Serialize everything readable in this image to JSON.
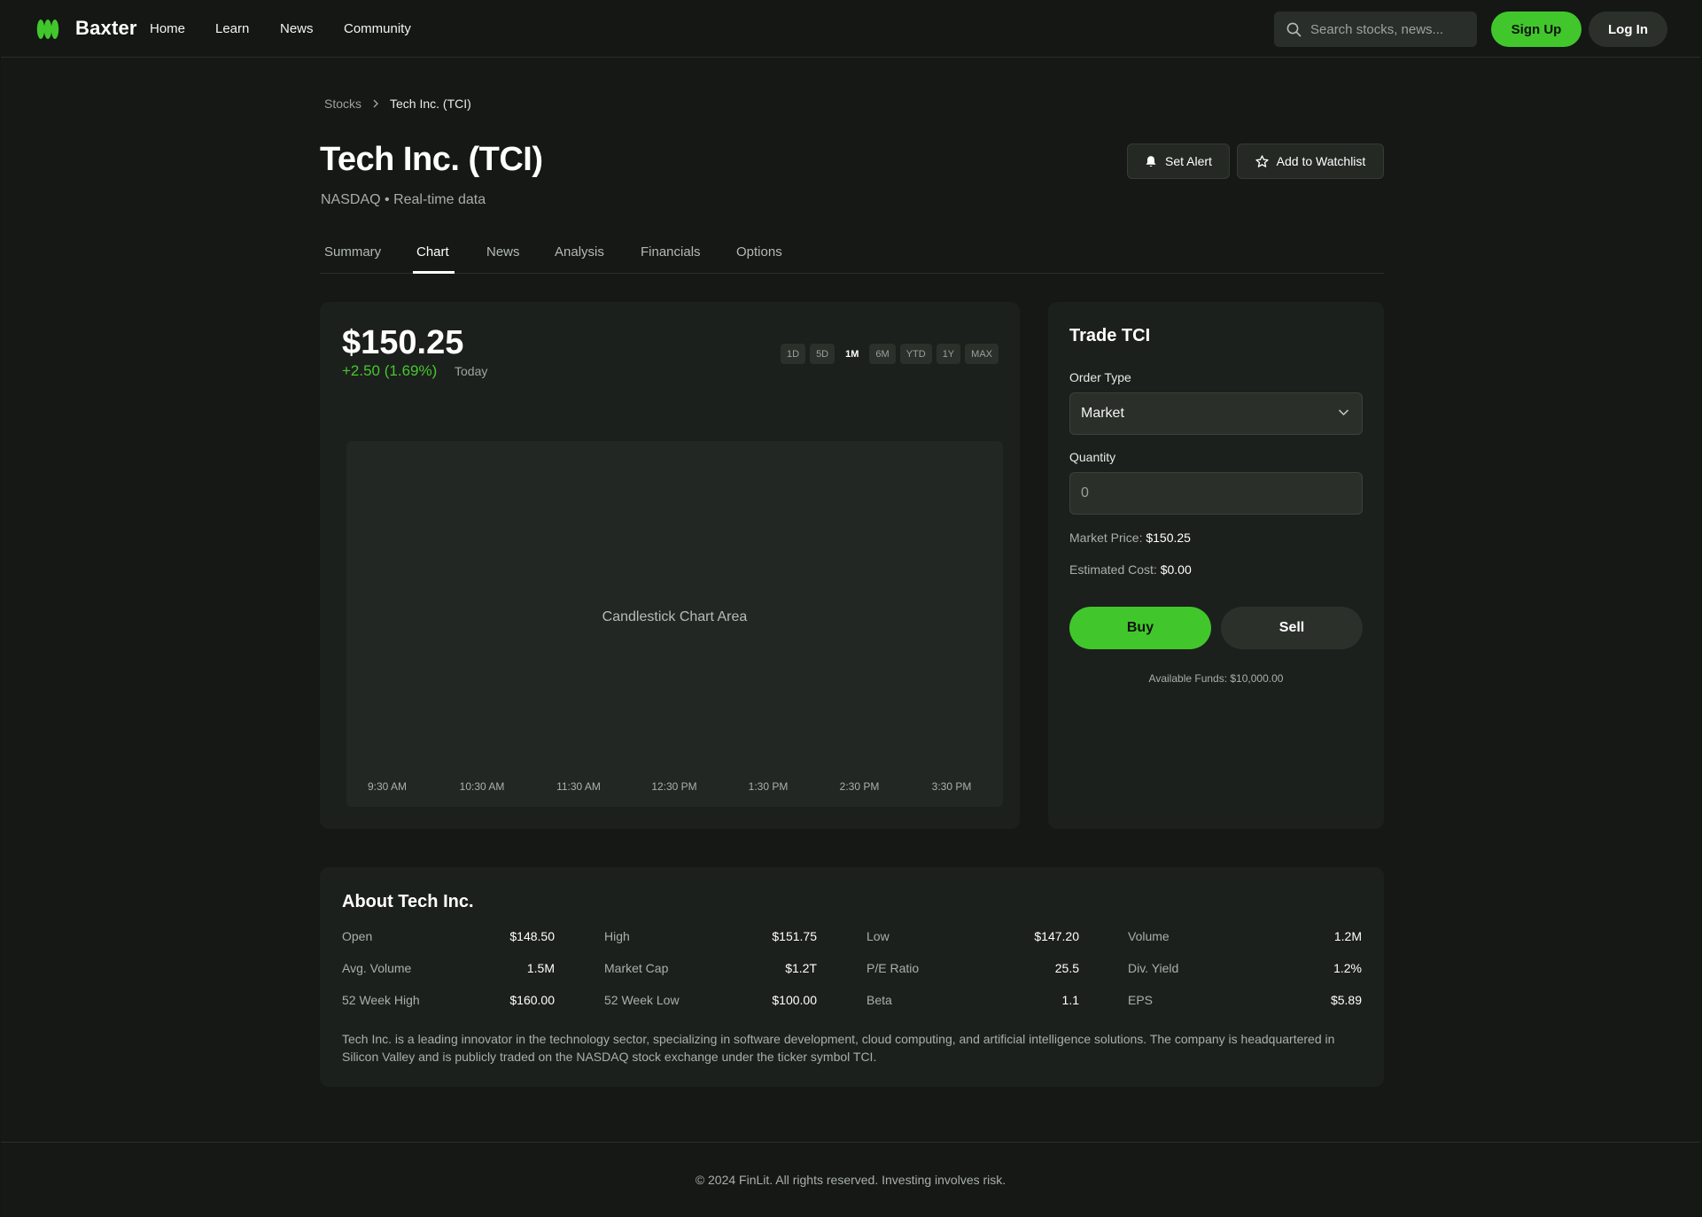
{
  "brand": {
    "name": "Baxter",
    "accent": "#41c72c"
  },
  "nav": {
    "links": [
      "Home",
      "Learn",
      "News",
      "Community"
    ],
    "search_placeholder": "Search stocks, news...",
    "signup_label": "Sign Up",
    "login_label": "Log In"
  },
  "breadcrumb": {
    "parent": "Stocks",
    "current": "Tech Inc. (TCI)"
  },
  "header": {
    "title": "Tech Inc. (TCI)",
    "subtitle": "NASDAQ • Real-time data",
    "set_alert_label": "Set Alert",
    "watchlist_label": "Add to Watchlist"
  },
  "tabs": [
    {
      "label": "Summary",
      "active": false
    },
    {
      "label": "Chart",
      "active": true
    },
    {
      "label": "News",
      "active": false
    },
    {
      "label": "Analysis",
      "active": false
    },
    {
      "label": "Financials",
      "active": false
    },
    {
      "label": "Options",
      "active": false
    }
  ],
  "chart": {
    "price": "$150.25",
    "change": "+2.50 (1.69%)",
    "period_label": "Today",
    "ranges": [
      "1D",
      "5D",
      "1M",
      "6M",
      "YTD",
      "1Y",
      "MAX"
    ],
    "active_range": "1M",
    "placeholder": "Candlestick Chart Area",
    "x_ticks": [
      "9:30 AM",
      "10:30 AM",
      "11:30 AM",
      "12:30 PM",
      "1:30 PM",
      "2:30 PM",
      "3:30 PM"
    ]
  },
  "trade": {
    "title": "Trade TCI",
    "order_type_label": "Order Type",
    "order_type_value": "Market",
    "quantity_label": "Quantity",
    "quantity_placeholder": "0",
    "market_price_label": "Market Price:",
    "market_price_value": "$150.25",
    "estimated_cost_label": "Estimated Cost:",
    "estimated_cost_value": "$0.00",
    "buy_label": "Buy",
    "sell_label": "Sell",
    "available_funds": "Available Funds: $10,000.00"
  },
  "about": {
    "title": "About Tech Inc.",
    "stats": [
      [
        {
          "label": "Open",
          "value": "$148.50"
        },
        {
          "label": "High",
          "value": "$151.75"
        },
        {
          "label": "Low",
          "value": "$147.20"
        },
        {
          "label": "Volume",
          "value": "1.2M"
        }
      ],
      [
        {
          "label": "Avg. Volume",
          "value": "1.5M"
        },
        {
          "label": "Market Cap",
          "value": "$1.2T"
        },
        {
          "label": "P/E Ratio",
          "value": "25.5"
        },
        {
          "label": "Div. Yield",
          "value": "1.2%"
        }
      ],
      [
        {
          "label": "52 Week High",
          "value": "$160.00"
        },
        {
          "label": "52 Week Low",
          "value": "$100.00"
        },
        {
          "label": "Beta",
          "value": "1.1"
        },
        {
          "label": "EPS",
          "value": "$5.89"
        }
      ]
    ],
    "description": "Tech Inc. is a leading innovator in the technology sector, specializing in software development, cloud computing, and artificial intelligence solutions. The company is headquartered in Silicon Valley and is publicly traded on the NASDAQ stock exchange under the ticker symbol TCI."
  },
  "footer": {
    "text": "© 2024 FinLit. All rights reserved. Investing involves risk."
  },
  "icons": {
    "logo": "logo-icon",
    "search": "search-icon",
    "alert": "bell-icon",
    "watchlist": "star-icon",
    "breadcrumb_separator": "chevron-right-icon",
    "select": "chevron-down-icon"
  }
}
